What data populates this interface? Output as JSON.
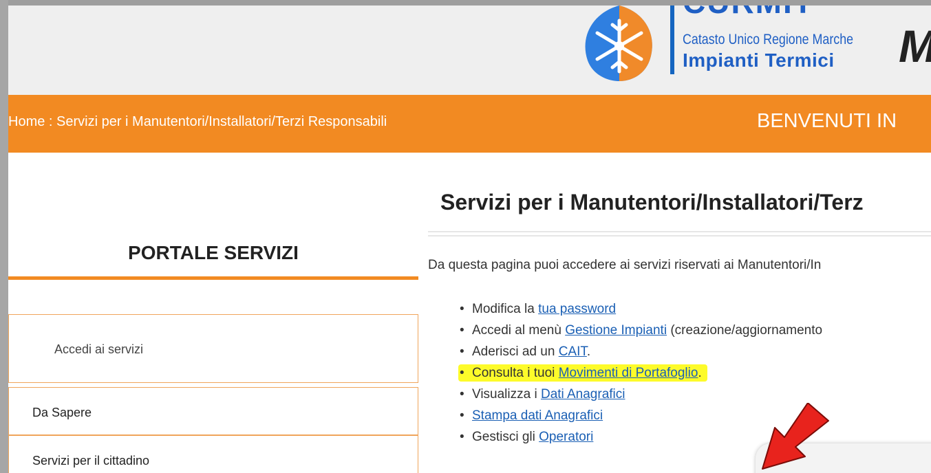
{
  "header": {
    "logo_line1": "Catasto Unico Regione Marche",
    "logo_line2": "Impianti Termici",
    "logo_acronym": "CURMIT",
    "logo_right_letter": "M"
  },
  "breadcrumb": {
    "home": "Home",
    "separator": " : ",
    "current": "Servizi per i Manutentori/Installatori/Terzi Responsabili"
  },
  "welcome": "BENVENUTI IN",
  "sidebar": {
    "title": "PORTALE SERVIZI",
    "access_label": "Accedi ai servizi",
    "items": [
      {
        "label": "Da Sapere"
      },
      {
        "label": "Servizi per il cittadino"
      }
    ]
  },
  "main": {
    "title": "Servizi per i Manutentori/Installatori/Terz",
    "intro": "Da questa pagina puoi accedere ai servizi riservati ai Manutentori/In",
    "services": [
      {
        "prefix": "Modifica la ",
        "link": "tua password",
        "suffix": ""
      },
      {
        "prefix": "Accedi al menù ",
        "link": "Gestione Impianti",
        "suffix": " (creazione/aggiornamento"
      },
      {
        "prefix": "Aderisci ad un ",
        "link": "CAIT",
        "suffix": "."
      },
      {
        "prefix": "Consulta i tuoi ",
        "link": "Movimenti di Portafoglio",
        "suffix": "."
      },
      {
        "prefix": "Visualizza i ",
        "link": "Dati Anagrafici",
        "suffix": ""
      },
      {
        "prefix": "",
        "link": "Stampa dati Anagrafici",
        "suffix": ""
      },
      {
        "prefix": "Gestisci gli ",
        "link": "Operatori",
        "suffix": ""
      }
    ]
  },
  "colors": {
    "accent_orange": "#f28a22",
    "link_blue": "#1a5fb4",
    "highlight_yellow": "#fdfb2a",
    "annotation_red": "#e8231d"
  },
  "annotations": {
    "highlighted_item_index": 3,
    "arrow_icon": "red-arrow-down-left-icon"
  }
}
